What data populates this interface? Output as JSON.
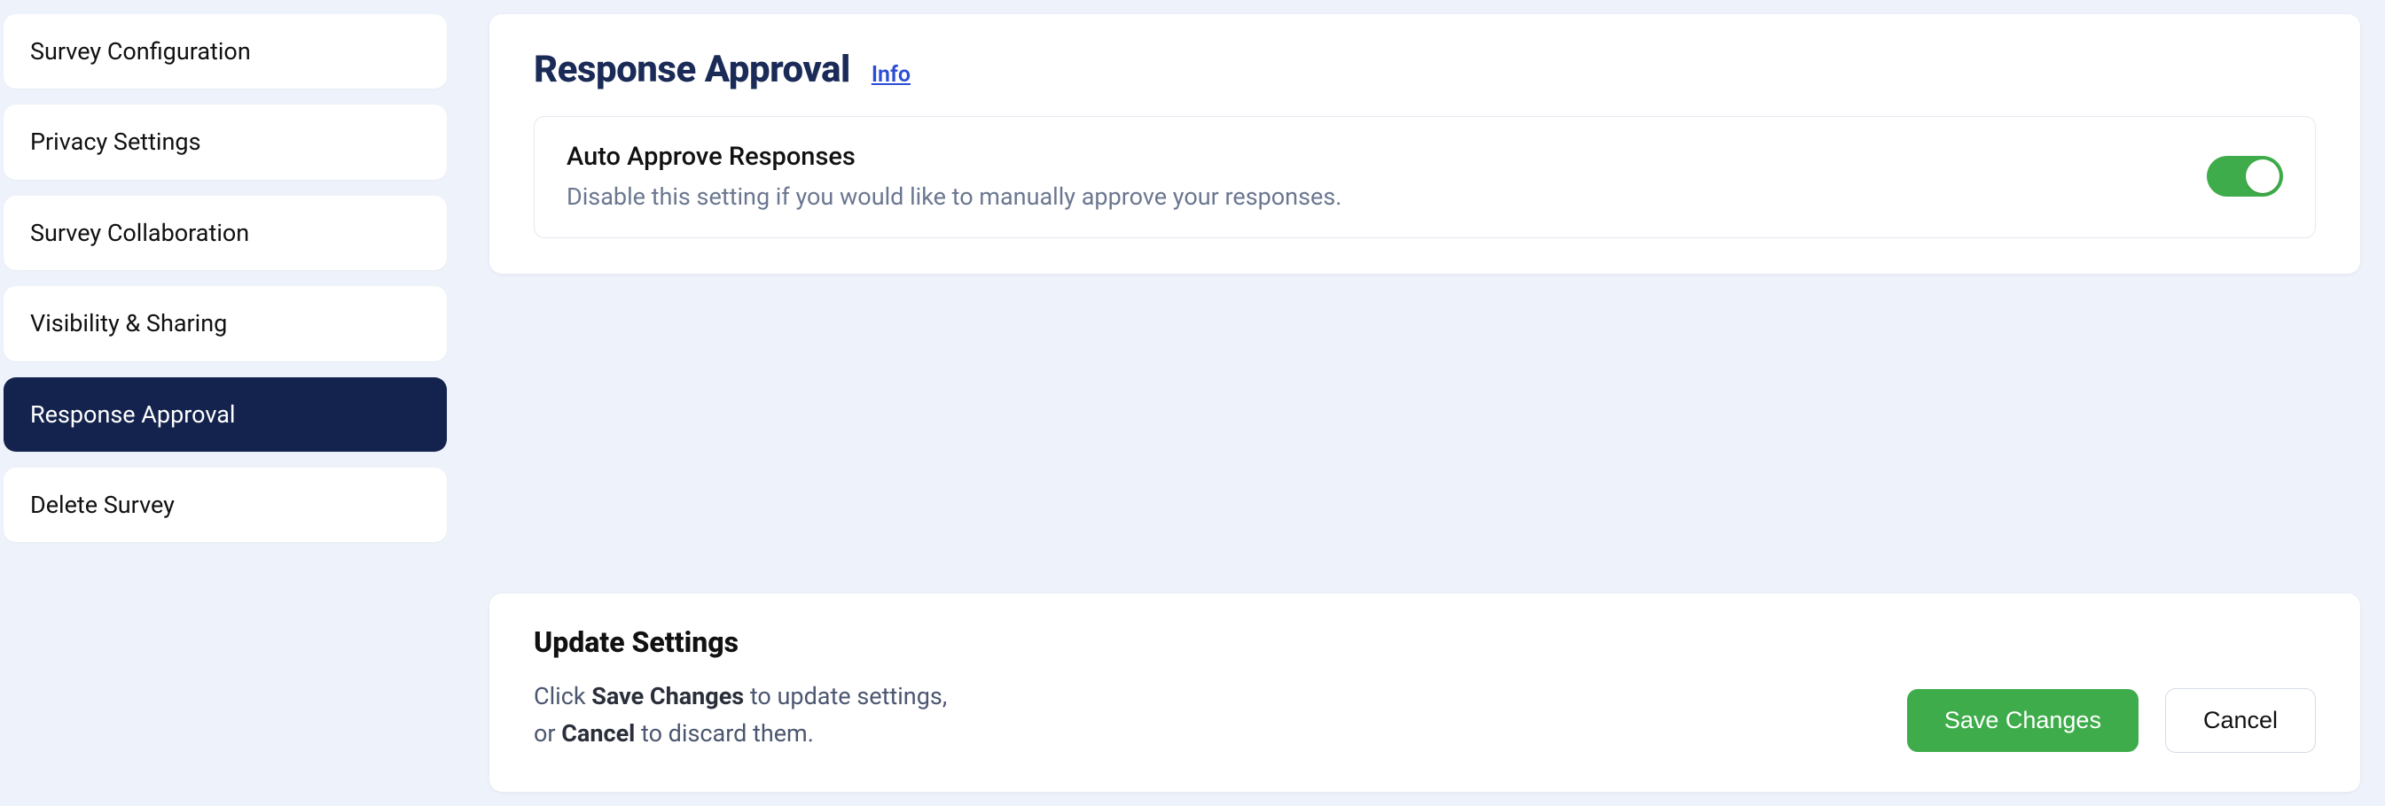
{
  "sidebar": {
    "items": [
      {
        "label": "Survey Configuration",
        "active": false
      },
      {
        "label": "Privacy Settings",
        "active": false
      },
      {
        "label": "Survey Collaboration",
        "active": false
      },
      {
        "label": "Visibility & Sharing",
        "active": false
      },
      {
        "label": "Response Approval",
        "active": true
      },
      {
        "label": "Delete Survey",
        "active": false
      }
    ]
  },
  "main": {
    "title": "Response Approval",
    "info_label": "Info",
    "setting": {
      "title": "Auto Approve Responses",
      "description": "Disable this setting if you would like to manually approve your responses.",
      "enabled": true
    }
  },
  "update": {
    "title": "Update Settings",
    "desc_pre": "Click ",
    "desc_strong1": "Save Changes",
    "desc_mid": " to update settings,",
    "desc_line2_pre": "or ",
    "desc_strong2": "Cancel",
    "desc_line2_post": " to discard them.",
    "save_label": "Save Changes",
    "cancel_label": "Cancel"
  }
}
